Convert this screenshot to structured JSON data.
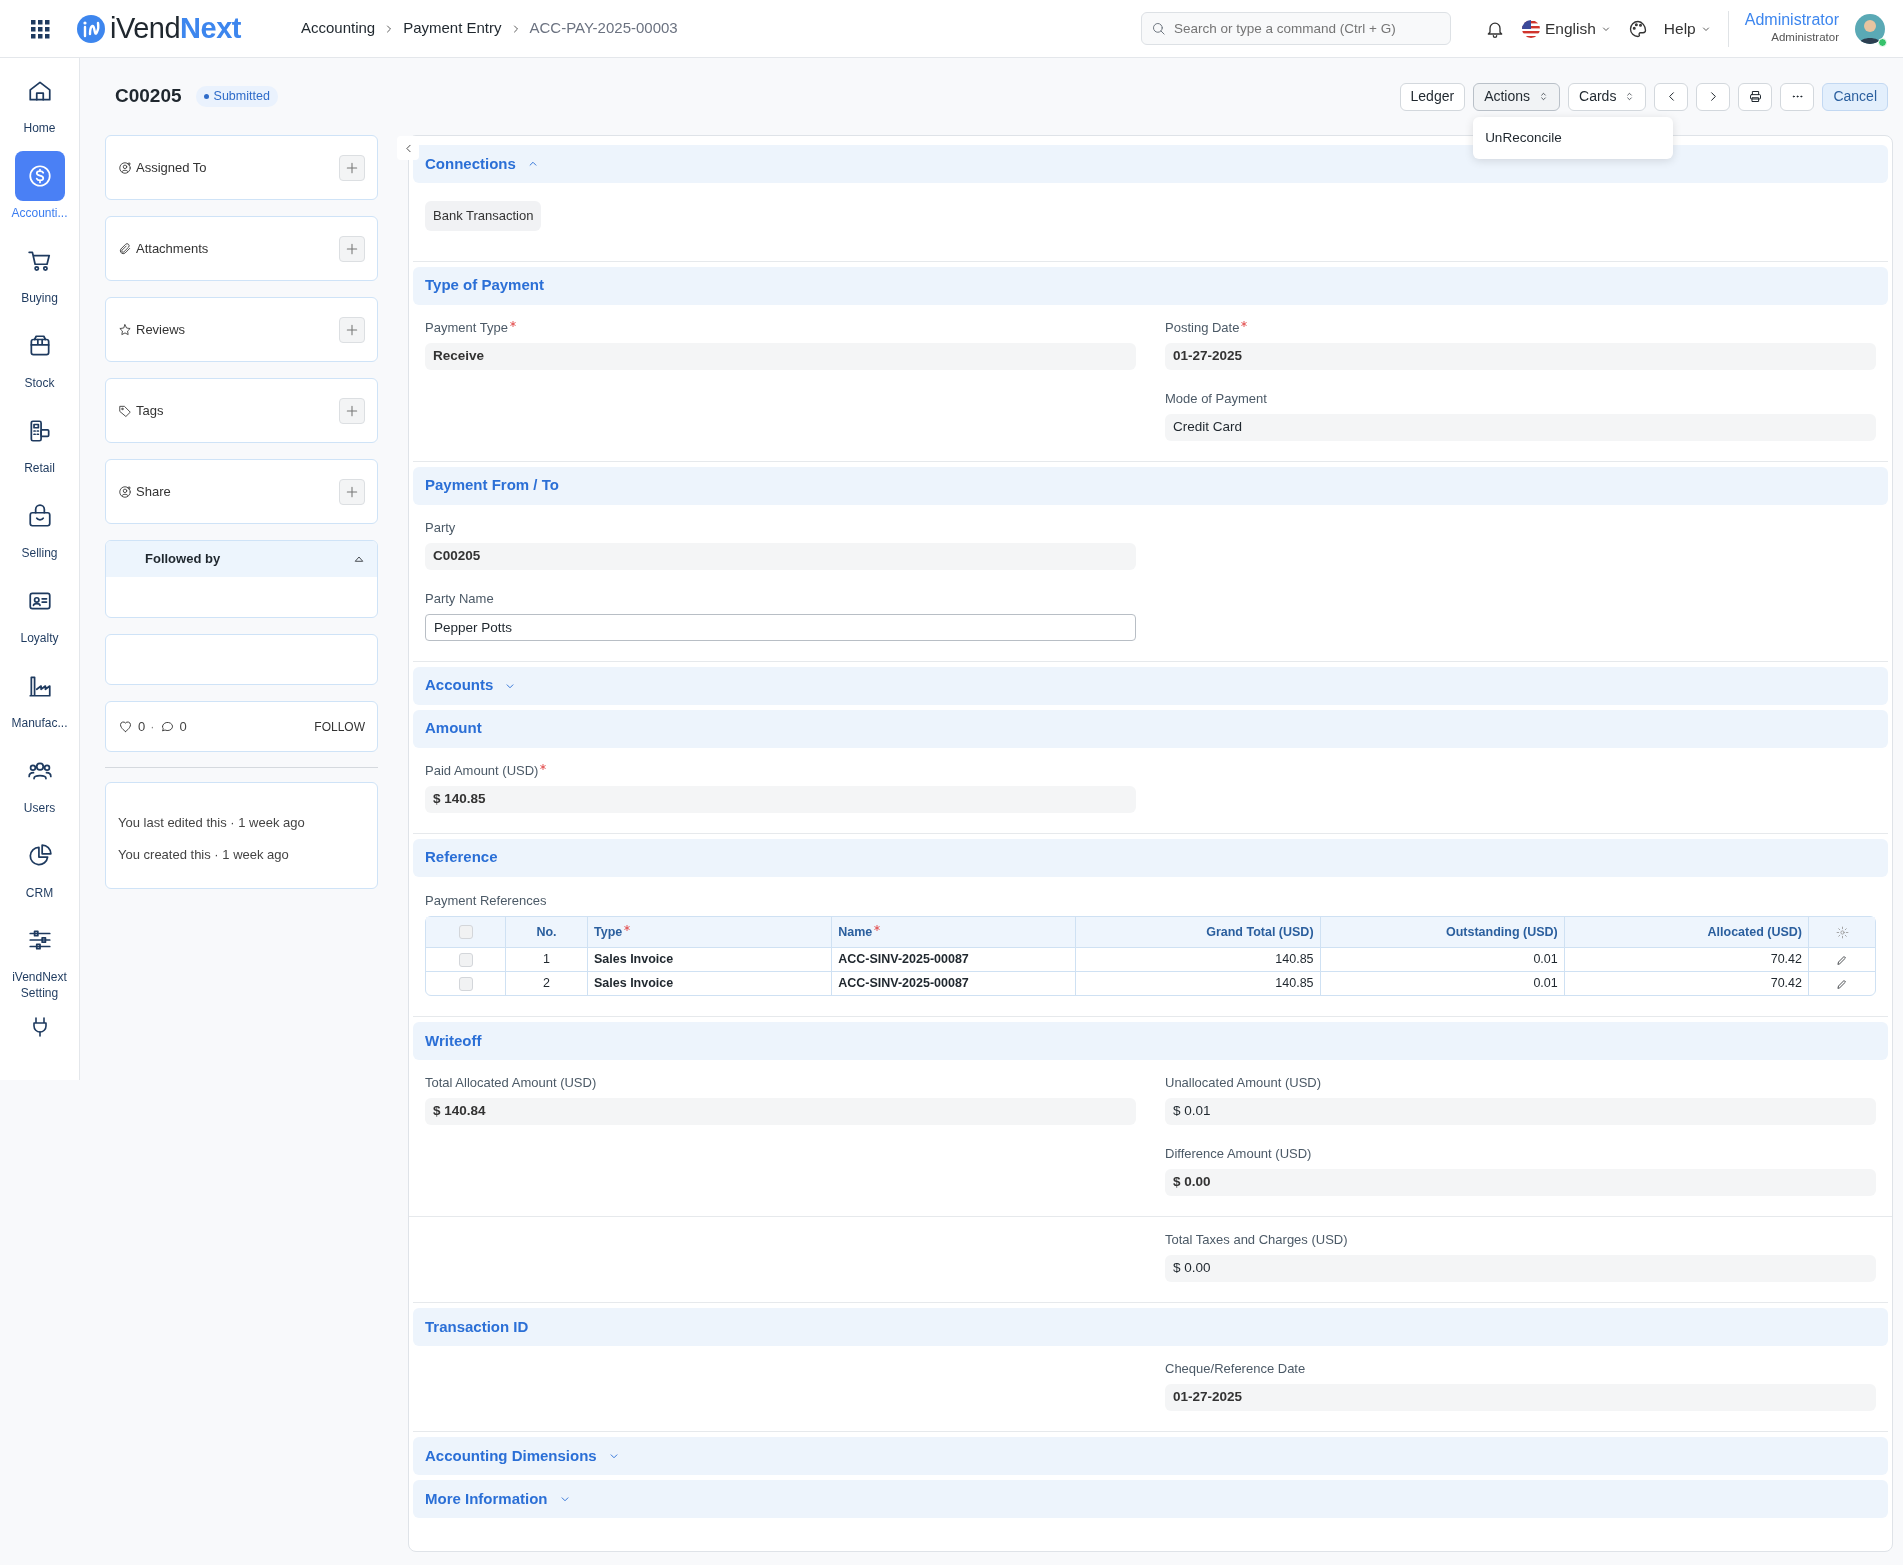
{
  "topbar": {
    "logo": {
      "first": "iVend",
      "second": "Next"
    },
    "breadcrumbs": [
      {
        "label": "Accounting",
        "current": false
      },
      {
        "label": "Payment Entry",
        "current": false
      },
      {
        "label": "ACC-PAY-2025-00003",
        "current": true
      }
    ],
    "search": {
      "placeholder": "Search or type a command (Ctrl + G)"
    },
    "language": "English",
    "help": "Help",
    "user": {
      "name": "Administrator",
      "role": "Administrator",
      "online": true
    }
  },
  "rail": [
    {
      "label": "Home",
      "selected": false
    },
    {
      "label": "Accounti...",
      "selected": true
    },
    {
      "label": "Buying",
      "selected": false
    },
    {
      "label": "Stock",
      "selected": false
    },
    {
      "label": "Retail",
      "selected": false
    },
    {
      "label": "Selling",
      "selected": false
    },
    {
      "label": "Loyalty",
      "selected": false
    },
    {
      "label": "Manufac...",
      "selected": false
    },
    {
      "label": "Users",
      "selected": false
    },
    {
      "label": "CRM",
      "selected": false
    },
    {
      "label": "iVendNext Setting",
      "selected": false
    }
  ],
  "header": {
    "title": "C00205",
    "status": "Submitted"
  },
  "toolbar": [
    {
      "kind": "text",
      "label": "Ledger"
    },
    {
      "kind": "dropdown",
      "label": "Actions",
      "open": true,
      "items": [
        "UnReconcile"
      ]
    },
    {
      "kind": "dropdown",
      "label": "Cards",
      "open": false
    },
    {
      "kind": "prev"
    },
    {
      "kind": "next"
    },
    {
      "kind": "print"
    },
    {
      "kind": "more"
    },
    {
      "kind": "accent",
      "label": "Cancel"
    }
  ],
  "sidebar": {
    "cards": [
      {
        "label": "Assigned To"
      },
      {
        "label": "Attachments"
      },
      {
        "label": "Reviews"
      },
      {
        "label": "Tags"
      },
      {
        "label": "Share"
      }
    ],
    "followed_by": {
      "title": "Followed by",
      "expanded": true
    },
    "likes": "0",
    "separator": "·",
    "comments": "0",
    "follow": "FOLLOW",
    "activity": [
      "You last edited this · 1 week ago",
      "You created this · 1 week ago"
    ]
  },
  "sections": [
    {
      "title": "Connections",
      "expanded": true,
      "links": [
        "Bank Transaction"
      ]
    },
    {
      "title": "Type of Payment",
      "blocks": [
        {
          "left": [
            {
              "label": "Payment Type",
              "required": true,
              "value": "Receive",
              "bold": true,
              "kind": "readonly"
            }
          ],
          "right": [
            {
              "label": "Posting Date",
              "required": true,
              "value": "01-27-2025",
              "bold": true,
              "kind": "readonly"
            },
            {
              "label": "Mode of Payment",
              "required": false,
              "value": "Credit Card",
              "bold": false,
              "kind": "readonly"
            }
          ]
        }
      ]
    },
    {
      "title": "Payment From / To",
      "blocks": [
        {
          "left": [
            {
              "label": "Party",
              "required": false,
              "value": "C00205",
              "bold": true,
              "kind": "readonly"
            },
            {
              "label": "Party Name",
              "required": false,
              "value": "Pepper Potts",
              "bold": false,
              "kind": "input"
            }
          ]
        }
      ]
    },
    {
      "title": "Accounts",
      "expanded": false
    },
    {
      "title": "Amount",
      "blocks": [
        {
          "left": [
            {
              "label": "Paid Amount (USD)",
              "required": true,
              "value": "$ 140.85",
              "bold": true,
              "kind": "readonly"
            }
          ]
        }
      ]
    },
    {
      "title": "Reference",
      "table": {
        "label": "Payment References",
        "all_selected": false,
        "columns": [
          {
            "label": "No.",
            "required": false
          },
          {
            "label": "Type",
            "required": true
          },
          {
            "label": "Name",
            "required": true
          },
          {
            "label": "Grand Total (USD)",
            "required": false
          },
          {
            "label": "Outstanding (USD)",
            "required": false
          },
          {
            "label": "Allocated (USD)",
            "required": false
          }
        ],
        "rows": [
          {
            "selected": false,
            "cells": [
              "1",
              "Sales Invoice",
              "ACC-SINV-2025-00087",
              "140.85",
              "0.01",
              "70.42"
            ]
          },
          {
            "selected": false,
            "cells": [
              "2",
              "Sales Invoice",
              "ACC-SINV-2025-00087",
              "140.85",
              "0.01",
              "70.42"
            ]
          }
        ]
      }
    },
    {
      "title": "Writeoff",
      "blocks": [
        {
          "left": [
            {
              "label": "Total Allocated Amount (USD)",
              "required": false,
              "value": "$ 140.84",
              "bold": true,
              "kind": "readonly"
            }
          ],
          "right": [
            {
              "label": "Unallocated Amount (USD)",
              "required": false,
              "value": "$ 0.01",
              "bold": false,
              "kind": "readonly"
            },
            {
              "label": "Difference Amount (USD)",
              "required": false,
              "value": "$ 0.00",
              "bold": true,
              "kind": "readonly"
            }
          ]
        },
        {
          "right": [
            {
              "label": "Total Taxes and Charges (USD)",
              "required": false,
              "value": "$ 0.00",
              "bold": false,
              "kind": "readonly"
            }
          ]
        }
      ]
    },
    {
      "title": "Transaction ID",
      "blocks": [
        {
          "right": [
            {
              "label": "Cheque/Reference Date",
              "required": false,
              "value": "01-27-2025",
              "bold": true,
              "kind": "readonly"
            }
          ]
        }
      ]
    },
    {
      "title": "Accounting Dimensions",
      "expanded": false
    },
    {
      "title": "More Information",
      "expanded": false
    }
  ]
}
